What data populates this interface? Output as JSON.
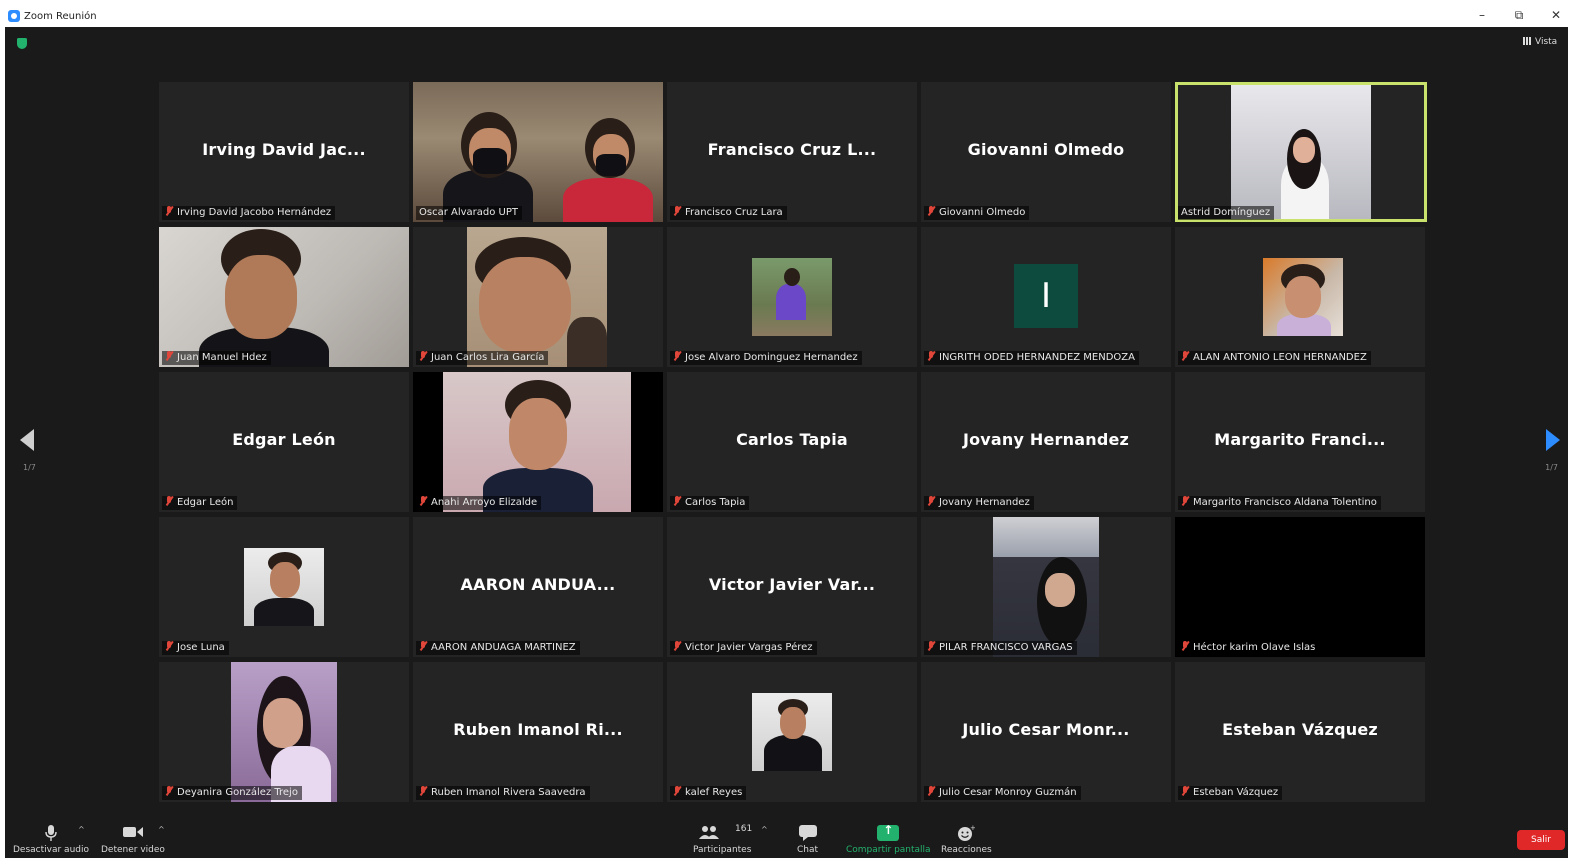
{
  "window": {
    "title": "Zoom Reunión",
    "minimize": "–",
    "restore": "⧉",
    "close": "✕"
  },
  "header": {
    "view_label": "Vista"
  },
  "pager": {
    "left": "1/7",
    "right": "1/7"
  },
  "participants": [
    {
      "big": "Irving David Jac...",
      "caption": "Irving David Jacobo Hernández",
      "muted": true
    },
    {
      "big": "",
      "caption": "Oscar Alvarado UPT",
      "muted": false
    },
    {
      "big": "Francisco Cruz L...",
      "caption": "Francisco Cruz Lara",
      "muted": true
    },
    {
      "big": "Giovanni Olmedo",
      "caption": "Giovanni Olmedo",
      "muted": true
    },
    {
      "big": "",
      "caption": "Astrid Domínguez",
      "muted": false
    },
    {
      "big": "",
      "caption": "Juan Manuel Hdez",
      "muted": true
    },
    {
      "big": "",
      "caption": "Juan Carlos Lira García",
      "muted": true
    },
    {
      "big": "",
      "caption": "Jose Alvaro Dominguez Hernandez",
      "muted": true
    },
    {
      "big": "I",
      "caption": "INGRITH ODED HERNANDEZ MENDOZA",
      "muted": true
    },
    {
      "big": "",
      "caption": "ALAN ANTONIO LEON HERNANDEZ",
      "muted": true
    },
    {
      "big": "Edgar León",
      "caption": "Edgar León",
      "muted": true
    },
    {
      "big": "",
      "caption": "Anahi Arroyo Elizalde",
      "muted": true
    },
    {
      "big": "Carlos Tapia",
      "caption": "Carlos Tapia",
      "muted": true
    },
    {
      "big": "Jovany Hernandez",
      "caption": "Jovany Hernandez",
      "muted": true
    },
    {
      "big": "Margarito Franci...",
      "caption": "Margarito Francisco Aldana Tolentino",
      "muted": true
    },
    {
      "big": "",
      "caption": "Jose Luna",
      "muted": true
    },
    {
      "big": "AARON ANDUA...",
      "caption": "AARON ANDUAGA MARTINEZ",
      "muted": true
    },
    {
      "big": "Victor Javier Var...",
      "caption": "Victor Javier Vargas Pérez",
      "muted": true
    },
    {
      "big": "",
      "caption": "PILAR FRANCISCO VARGAS",
      "muted": true
    },
    {
      "big": "",
      "caption": "Héctor karim Olave Islas",
      "muted": true
    },
    {
      "big": "",
      "caption": "Deyanira González Trejo",
      "muted": true
    },
    {
      "big": "Ruben Imanol Ri...",
      "caption": "Ruben Imanol Rivera Saavedra",
      "muted": true
    },
    {
      "big": "",
      "caption": "kalef Reyes",
      "muted": true
    },
    {
      "big": "Julio Cesar Monr...",
      "caption": "Julio Cesar Monroy Guzmán",
      "muted": true
    },
    {
      "big": "Esteban Vázquez",
      "caption": "Esteban Vázquez",
      "muted": true
    }
  ],
  "toolbar": {
    "audio": "Desactivar audio",
    "video": "Detener video",
    "participants": "Participantes",
    "participants_count": "161",
    "chat": "Chat",
    "share": "Compartir pantalla",
    "reactions": "Reacciones",
    "leave": "Salir"
  },
  "colors": {
    "accent": "#2d8cff",
    "active_speaker": "#c8e26b",
    "share": "#23b26d",
    "leave": "#e02828"
  }
}
